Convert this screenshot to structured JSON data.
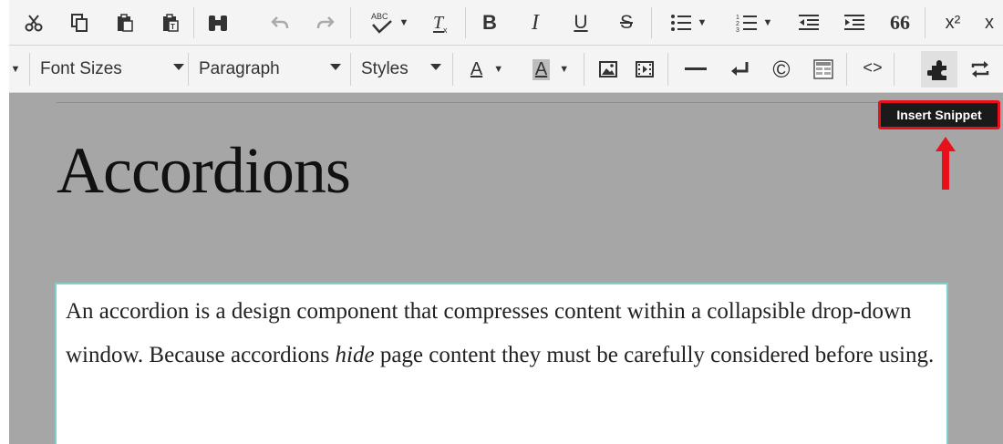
{
  "toolbar_row1": {
    "spellcheck_label": "ABC",
    "bold": "B",
    "italic": "I",
    "underline": "U",
    "strike": "S",
    "blockquote": "66",
    "superscript": "x²",
    "subscript": "x"
  },
  "toolbar_row2": {
    "font_sizes_label": "Font Sizes",
    "paragraph_label": "Paragraph",
    "styles_label": "Styles",
    "text_color_label": "A",
    "bg_color_label": "A",
    "copyright": "©",
    "source_code": "<>"
  },
  "tooltip": {
    "text": "Insert Snippet"
  },
  "document": {
    "heading": "Accordions",
    "para_part1": "An accordion is a design component that compresses content within a collapsible drop-down window. Because accordions ",
    "para_emphasis": "hide",
    "para_part2": " page content they must be carefully considered before using."
  },
  "colors": {
    "toolbar_bg": "#f4f4f4",
    "content_bg": "#a6a6a6",
    "highlight_red": "#e8111b",
    "para_border": "#7fcfcf"
  }
}
